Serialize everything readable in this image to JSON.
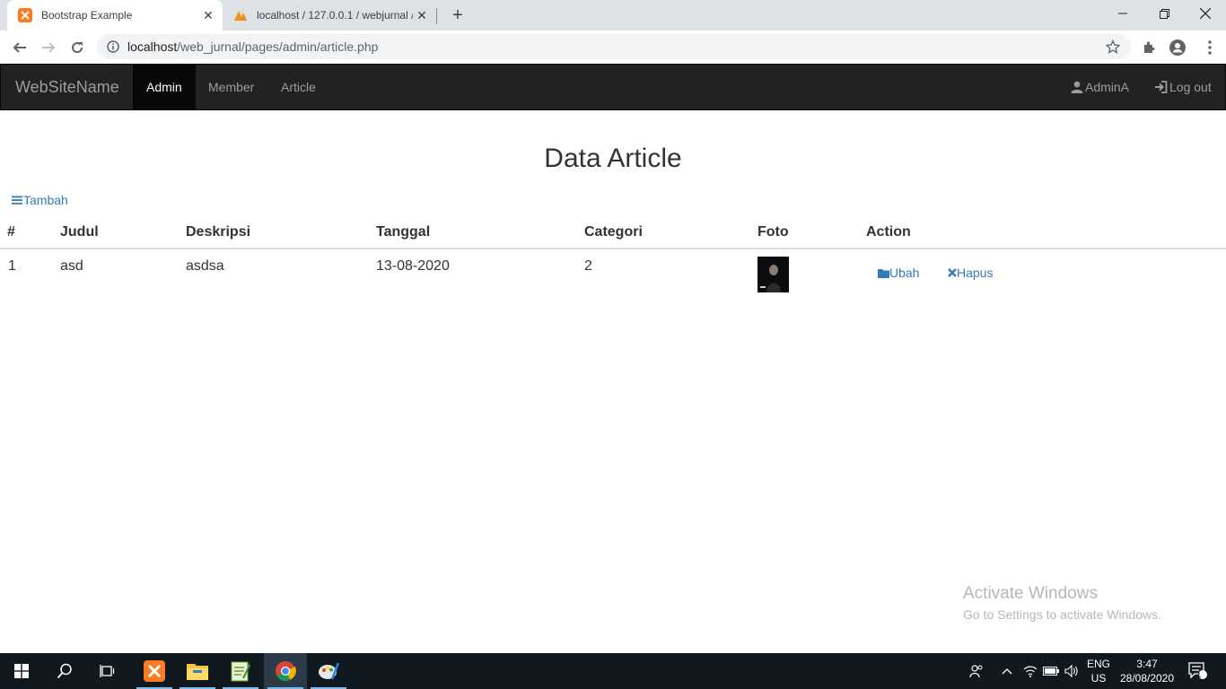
{
  "browser": {
    "tabs": [
      {
        "title": "Bootstrap Example",
        "active": true
      },
      {
        "title": "localhost / 127.0.0.1 / webjurnal /",
        "active": false
      }
    ],
    "url_host": "localhost",
    "url_path": "/web_jurnal/pages/admin/article.php"
  },
  "navbar": {
    "brand": "WebSiteName",
    "links": [
      "Admin",
      "Member",
      "Article"
    ],
    "active_link": "Admin",
    "user": "AdminA",
    "logout": "Log out"
  },
  "main": {
    "title": "Data Article",
    "add_label": "Tambah",
    "columns": [
      "#",
      "Judul",
      "Deskripsi",
      "Tanggal",
      "Categori",
      "Foto",
      "Action"
    ],
    "rows": [
      {
        "no": "1",
        "judul": "asd",
        "deskripsi": "asdsa",
        "tanggal": "13-08-2020",
        "categori": "2",
        "edit": "Ubah",
        "delete": "Hapus"
      }
    ]
  },
  "watermark": {
    "line1": "Activate Windows",
    "line2": "Go to Settings to activate Windows."
  },
  "taskbar": {
    "lang1": "ENG",
    "lang2": "US",
    "time": "3:47",
    "date": "28/08/2020",
    "notification_count": "1"
  },
  "colors": {
    "navbar_bg": "#222222",
    "link": "#337ab7",
    "taskbar_bg": "#101820"
  }
}
